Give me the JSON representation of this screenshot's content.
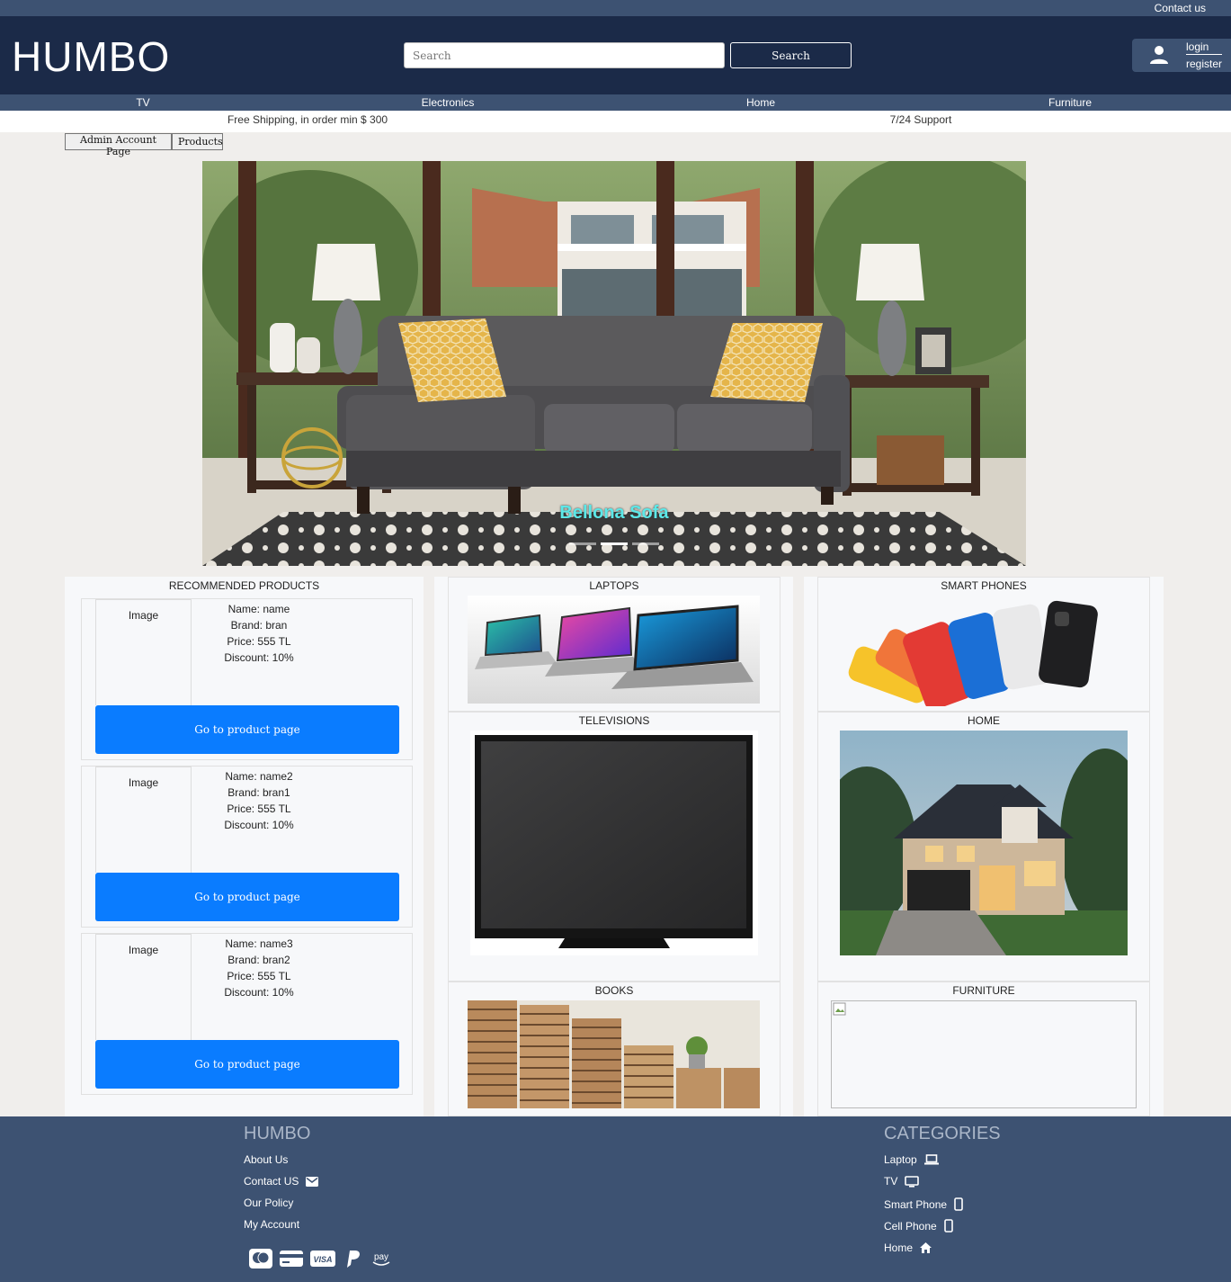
{
  "topbar": {
    "contact": "Contact us"
  },
  "header": {
    "logo": "HUMBO",
    "search_placeholder": "Search",
    "search_button": "Search",
    "login": "login",
    "register": "register"
  },
  "nav": {
    "items": [
      "TV",
      "Electronics",
      "Home",
      "Furniture"
    ]
  },
  "info": {
    "shipping": "Free Shipping, in order min $ 300",
    "support": "7/24 Support"
  },
  "admin": {
    "admin_button": "Admin Account Page",
    "products_button": "Products"
  },
  "hero": {
    "caption": "Bellona Sofa",
    "slides": 3,
    "active_slide": 2
  },
  "recommended": {
    "title": "RECOMMENDED PRODUCTS",
    "items": [
      {
        "image": "Image",
        "name": "Name: name",
        "brand": "Brand: bran",
        "price": "Price: 555 TL",
        "discount": "Discount: 10%",
        "button": "Go to product page"
      },
      {
        "image": "Image",
        "name": "Name: name2",
        "brand": "Brand: bran1",
        "price": "Price: 555 TL",
        "discount": "Discount: 10%",
        "button": "Go to product page"
      },
      {
        "image": "Image",
        "name": "Name: name3",
        "brand": "Brand: bran2",
        "price": "Price: 555 TL",
        "discount": "Discount: 10%",
        "button": "Go to product page"
      }
    ]
  },
  "categories": {
    "laptops": "LAPTOPS",
    "televisions": "TELEVISIONS",
    "books": "BOOKS",
    "smart_phones": "SMART PHONES",
    "home": "HOME",
    "furniture": "FURNITURE"
  },
  "footer": {
    "brand": "HUMBO",
    "links": [
      "About Us",
      "Contact US",
      "Our Policy",
      "My Account"
    ],
    "categories_title": "CATEGORIES",
    "categories": [
      "Laptop",
      "TV",
      "Smart Phone",
      "Cell Phone",
      "Home"
    ],
    "payment_icons": [
      "mastercard-icon",
      "credit-card-icon",
      "visa-icon",
      "paypal-icon",
      "amazon-pay-icon"
    ],
    "payment_labels": {
      "visa": "VISA",
      "amazon": "pay"
    }
  },
  "colors": {
    "header": "#1b2a48",
    "bar": "#3d5272",
    "button": "#0a7cff",
    "page_bg": "#f0eeec",
    "caption": "#5ce8e8"
  }
}
